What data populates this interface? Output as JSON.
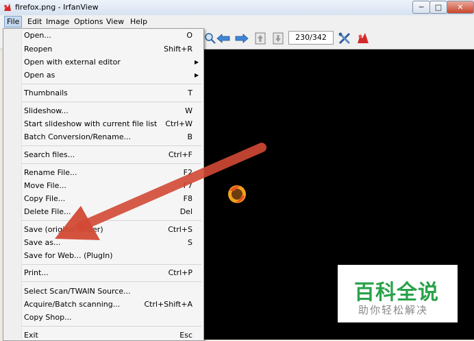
{
  "window": {
    "title": "firefox.png - IrfanView",
    "minimize": "─",
    "maximize": "□",
    "close": "✕",
    "icon": "irfanview-logo-icon"
  },
  "menubar": [
    "File",
    "Edit",
    "Image",
    "Options",
    "View",
    "Help"
  ],
  "toolbar": {
    "page_counter": "230/342",
    "icons": [
      "zoom-icon",
      "prev-arrow-icon",
      "next-arrow-icon",
      "page-up-icon",
      "page-down-icon",
      "tools-icon",
      "irfanview-logo-icon"
    ]
  },
  "file_menu": {
    "items": [
      {
        "label": "Open...",
        "shortcut": "O"
      },
      {
        "label": "Reopen",
        "shortcut": "Shift+R"
      },
      {
        "label": "Open with external editor",
        "submenu": true
      },
      {
        "label": "Open as",
        "submenu": true
      },
      {
        "label": "Thumbnails",
        "shortcut": "T"
      },
      {
        "label": "Slideshow...",
        "shortcut": "W"
      },
      {
        "label": "Start slideshow with current file list",
        "shortcut": "Ctrl+W"
      },
      {
        "label": "Batch Conversion/Rename...",
        "shortcut": "B"
      },
      {
        "label": "Search files...",
        "shortcut": "Ctrl+F"
      },
      {
        "label": "Rename File...",
        "shortcut": "F2"
      },
      {
        "label": "Move File...",
        "shortcut": "F7"
      },
      {
        "label": "Copy File...",
        "shortcut": "F8"
      },
      {
        "label": "Delete File...",
        "shortcut": "Del"
      },
      {
        "label": "Save (original folder)",
        "shortcut": "Ctrl+S"
      },
      {
        "label": "Save as...",
        "shortcut": "S"
      },
      {
        "label": "Save for Web... (PlugIn)",
        "shortcut": ""
      },
      {
        "label": "Print...",
        "shortcut": "Ctrl+P"
      },
      {
        "label": "Select Scan/TWAIN Source...",
        "shortcut": ""
      },
      {
        "label": "Acquire/Batch scanning...",
        "shortcut": "Ctrl+Shift+A"
      },
      {
        "label": "Copy Shop...",
        "shortcut": ""
      },
      {
        "label": "Exit",
        "shortcut": "Esc"
      }
    ],
    "submenu_arrow": "▶"
  },
  "watermark": {
    "title": "百科全说",
    "subtitle": "助你轻松解决",
    "color": "#2aa24a"
  },
  "annotation_arrow_color": "#d24a35"
}
